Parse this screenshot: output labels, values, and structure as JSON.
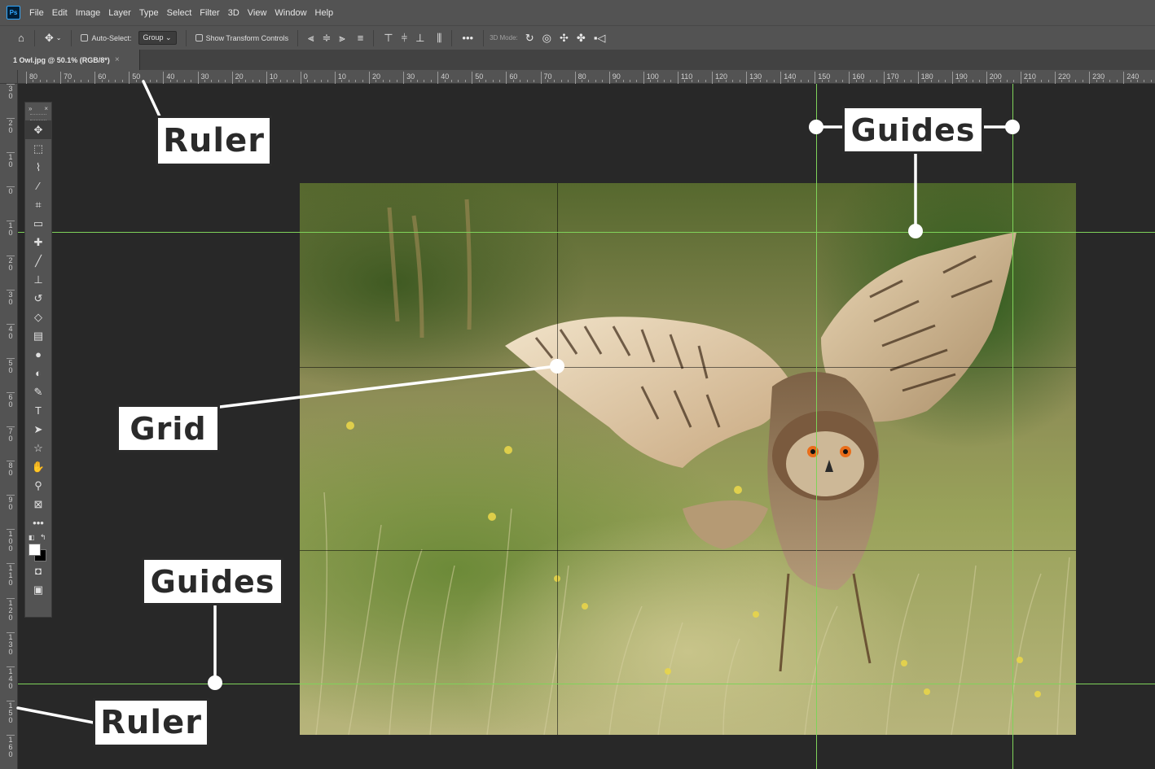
{
  "app": {
    "logo_text": "Ps"
  },
  "menu": [
    "File",
    "Edit",
    "Image",
    "Layer",
    "Type",
    "Select",
    "Filter",
    "3D",
    "View",
    "Window",
    "Help"
  ],
  "options_bar": {
    "auto_select_label": "Auto-Select:",
    "group_value": "Group",
    "show_transform_label": "Show Transform Controls",
    "mode_label": "3D Mode:",
    "more_label": "•••"
  },
  "document_tab": {
    "title": "1 Owl.jpg @ 50.1% (RGB/8*)",
    "close": "×"
  },
  "ruler_top_labels": [
    "80",
    "70",
    "60",
    "50",
    "40",
    "30",
    "20",
    "10",
    "0",
    "10",
    "20",
    "30",
    "40",
    "50",
    "60",
    "70",
    "80",
    "90",
    "100",
    "110",
    "120",
    "130",
    "140",
    "150",
    "160",
    "170",
    "180",
    "190",
    "200",
    "210",
    "220",
    "230",
    "240"
  ],
  "ruler_left_labels": [
    "3 0",
    "2 0",
    "1 0",
    "0",
    "1 0",
    "2 0",
    "3 0",
    "4 0",
    "5 0",
    "6 0",
    "7 0",
    "8 0",
    "9 0",
    "1 0 0",
    "1 1 0",
    "1 2 0",
    "1 3 0",
    "1 4 0",
    "1 5 0",
    "1 6 0"
  ],
  "toolbar": {
    "header_expand": "»",
    "header_close": "×",
    "tools": [
      {
        "name": "move-tool",
        "glyph": "✥"
      },
      {
        "name": "marquee-tool",
        "glyph": "⬚"
      },
      {
        "name": "lasso-tool",
        "glyph": "⌇"
      },
      {
        "name": "magic-wand-tool",
        "glyph": "⁄"
      },
      {
        "name": "crop-tool",
        "glyph": "⌗"
      },
      {
        "name": "ruler-tool",
        "glyph": "▭"
      },
      {
        "name": "healing-brush-tool",
        "glyph": "✚"
      },
      {
        "name": "brush-tool",
        "glyph": "╱"
      },
      {
        "name": "clone-stamp-tool",
        "glyph": "⊥"
      },
      {
        "name": "history-brush-tool",
        "glyph": "↺"
      },
      {
        "name": "eraser-tool",
        "glyph": "◇"
      },
      {
        "name": "gradient-tool",
        "glyph": "▤"
      },
      {
        "name": "blur-tool",
        "glyph": "●"
      },
      {
        "name": "dodge-tool",
        "glyph": "◐"
      },
      {
        "name": "pen-tool",
        "glyph": "✎"
      },
      {
        "name": "type-tool",
        "glyph": "T"
      },
      {
        "name": "path-selection-tool",
        "glyph": "➤"
      },
      {
        "name": "shape-tool",
        "glyph": "☆"
      },
      {
        "name": "hand-tool",
        "glyph": "✋"
      },
      {
        "name": "zoom-tool",
        "glyph": "⚲"
      },
      {
        "name": "frame-tool",
        "glyph": "⊠"
      },
      {
        "name": "more-tools",
        "glyph": "•••"
      }
    ],
    "quick_mask_glyph": "◘",
    "screen_mode_glyph": "▣"
  },
  "callouts": {
    "ruler_top": "Ruler",
    "ruler_bottom": "Ruler",
    "guides_top": "Guides",
    "guides_bottom": "Guides",
    "grid": "Grid"
  },
  "colors": {
    "guide": "#7fd35a",
    "ui_panel": "#535353",
    "canvas_bg": "#282828",
    "foreground": "#ffffff",
    "background": "#000000"
  }
}
